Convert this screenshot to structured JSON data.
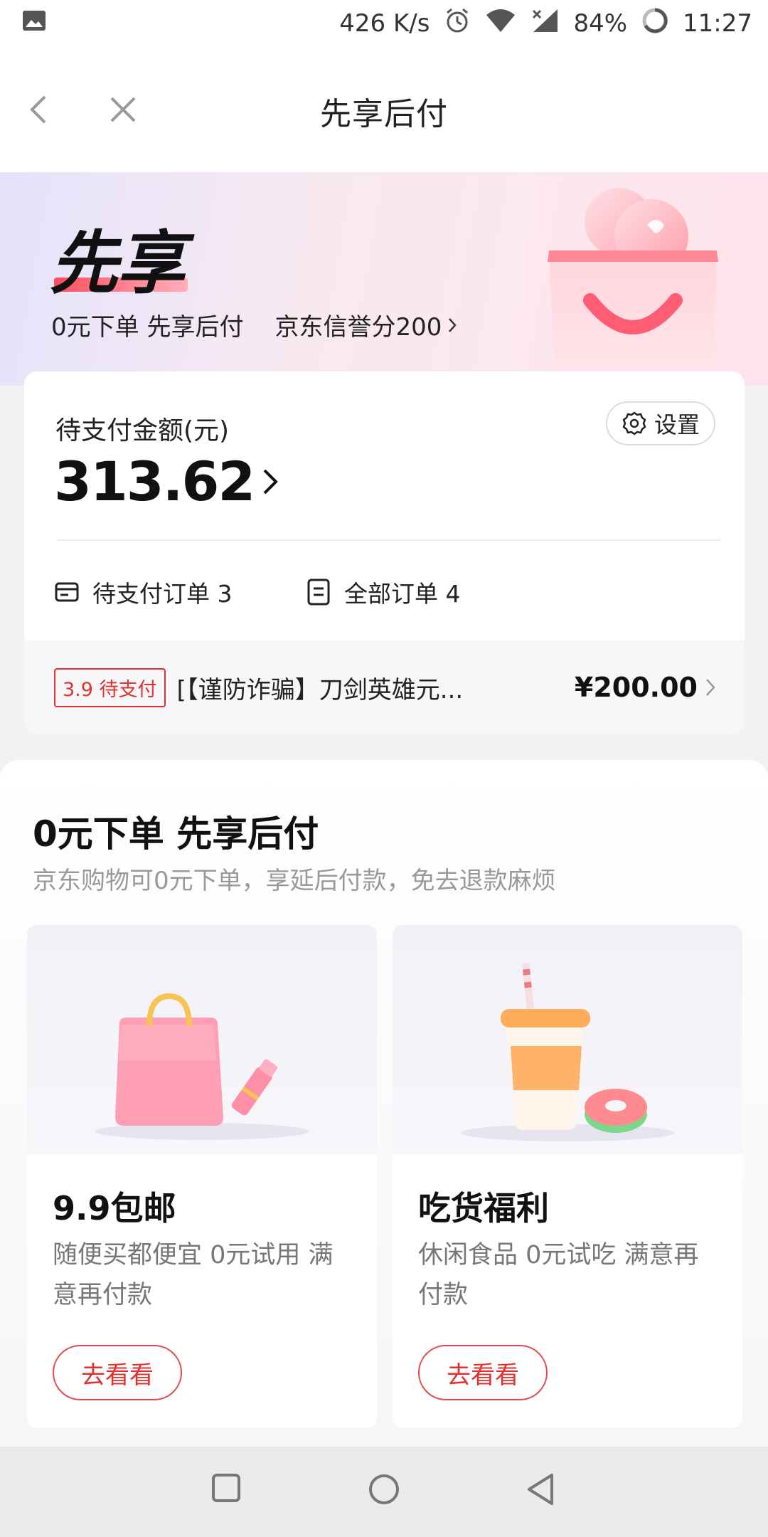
{
  "status_bar": {
    "speed": "426 K/s",
    "battery": "84%",
    "time": "11:27"
  },
  "nav": {
    "title": "先享后付"
  },
  "hero": {
    "title": "先享",
    "subtitle_left": "0元下单 先享后付",
    "credit": "京东信誉分200"
  },
  "payment": {
    "label": "待支付金额(元)",
    "amount": "313.62",
    "settings_label": "设置",
    "pending_orders": "待支付订单 3",
    "all_orders": "全部订单 4"
  },
  "pending_order": {
    "tag": "3.9 待支付",
    "name": "[【谨防诈骗】刀剑英雄元...",
    "price": "¥200.00"
  },
  "promo": {
    "title": "0元下单 先享后付",
    "subtitle": "京东购物可0元下单，享延后付款，免去退款麻烦",
    "cards": [
      {
        "title": "9.9包邮",
        "desc": "随便买都便宜 0元试用 满意再付款",
        "button": "去看看"
      },
      {
        "title": "吃货福利",
        "desc": "休闲食品 0元试吃 满意再付款",
        "button": "去看看"
      }
    ]
  },
  "colors": {
    "accent": "#e0312f",
    "muted_text": "#999999"
  }
}
